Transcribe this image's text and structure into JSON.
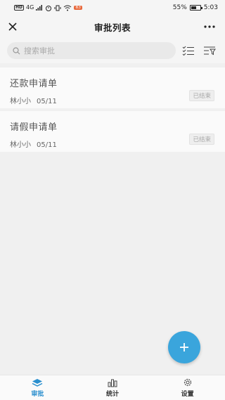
{
  "status_bar": {
    "time": "5:03",
    "battery": "55%",
    "network": "4G",
    "badge": "83"
  },
  "header": {
    "title": "审批列表"
  },
  "search": {
    "placeholder": "搜索审批"
  },
  "items": [
    {
      "title": "还款申请单",
      "applicant": "林小小",
      "date": "05/11",
      "status": "已结束"
    },
    {
      "title": "请假申请单",
      "applicant": "林小小",
      "date": "05/11",
      "status": "已结束"
    }
  ],
  "tabs": [
    {
      "label": "审批",
      "icon": "layers-icon",
      "active": true
    },
    {
      "label": "统计",
      "icon": "bar-chart-icon",
      "active": false
    },
    {
      "label": "设置",
      "icon": "gear-icon",
      "active": false
    }
  ],
  "colors": {
    "accent": "#3aa5dc",
    "active_tab": "#2a8fce"
  }
}
